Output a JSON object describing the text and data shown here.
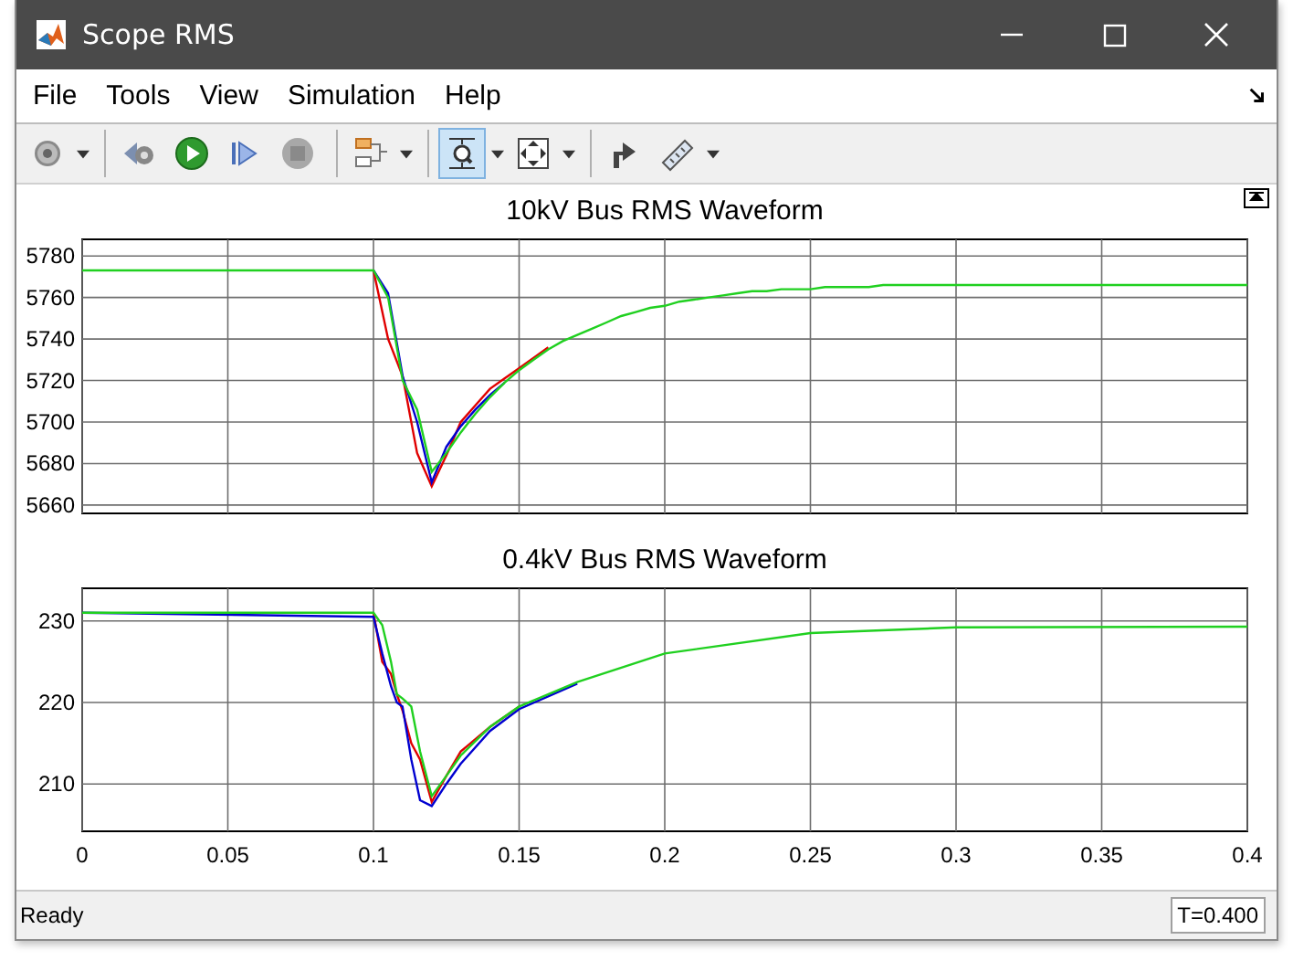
{
  "window": {
    "title": "Scope RMS"
  },
  "menu": [
    "File",
    "Tools",
    "View",
    "Simulation",
    "Help"
  ],
  "toolbar": [
    {
      "kind": "gear",
      "dropdown": true,
      "selected": false
    },
    {
      "kind": "separator"
    },
    {
      "kind": "step-back",
      "dropdown": false,
      "selected": false
    },
    {
      "kind": "run",
      "dropdown": false,
      "selected": false
    },
    {
      "kind": "step-forward",
      "dropdown": false,
      "selected": false
    },
    {
      "kind": "stop",
      "dropdown": false,
      "selected": false
    },
    {
      "kind": "separator"
    },
    {
      "kind": "signals",
      "dropdown": true,
      "selected": false
    },
    {
      "kind": "separator"
    },
    {
      "kind": "zoom",
      "dropdown": true,
      "selected": true
    },
    {
      "kind": "fit",
      "dropdown": true,
      "selected": false
    },
    {
      "kind": "separator"
    },
    {
      "kind": "highlight",
      "dropdown": false,
      "selected": false
    },
    {
      "kind": "ruler",
      "dropdown": true,
      "selected": false
    }
  ],
  "plots": [
    {
      "chart_data": {
        "type": "line",
        "title": "10kV Bus RMS Waveform",
        "grid": true,
        "categories": [
          null,
          null,
          null,
          null,
          null,
          null,
          null,
          null,
          null,
          null,
          null,
          null,
          null,
          null,
          null,
          null,
          null,
          null,
          null,
          null,
          null,
          null,
          null,
          null,
          null,
          null,
          null,
          null,
          null,
          null,
          null,
          null,
          null,
          null,
          null,
          null,
          null,
          null,
          null,
          null,
          null,
          null,
          null,
          null,
          null,
          null,
          null,
          null,
          null,
          null,
          null,
          null,
          null,
          null,
          null,
          null,
          null,
          null,
          null,
          null,
          null,
          null,
          null,
          null,
          null,
          null,
          null,
          null,
          null,
          null,
          null,
          null,
          null,
          null,
          null,
          null,
          null,
          null,
          null,
          null,
          null
        ],
        "series": [
          {
            "color": "#e00000",
            "values": [
              null,
              null,
              null,
              null,
              null,
              null,
              null,
              null,
              null,
              null,
              null,
              null,
              null,
              null,
              null,
              null,
              null,
              null,
              null,
              null,
              5773,
              5740,
              5722,
              5685,
              5669,
              5684,
              5700,
              5708,
              5716,
              5721,
              5726,
              5731,
              5736,
              null,
              null,
              null,
              null,
              null,
              null,
              null,
              null,
              null,
              null,
              null,
              null,
              null,
              null,
              null,
              null,
              null,
              null,
              null,
              null,
              null,
              null,
              null,
              null,
              null,
              null,
              null,
              null,
              null,
              null,
              null,
              null,
              null,
              null,
              null,
              null,
              null,
              null,
              null,
              null,
              null,
              null,
              null,
              null,
              null,
              null,
              null,
              null
            ]
          },
          {
            "color": "#0000d0",
            "values": [
              null,
              null,
              null,
              null,
              null,
              null,
              null,
              null,
              null,
              null,
              null,
              null,
              null,
              null,
              null,
              null,
              null,
              null,
              null,
              null,
              5773,
              5762,
              5722,
              5700,
              5671,
              5688,
              5698,
              5706,
              5713,
              5719,
              null,
              null,
              null,
              null,
              null,
              null,
              null,
              null,
              null,
              null,
              null,
              null,
              null,
              null,
              null,
              null,
              null,
              null,
              null,
              null,
              null,
              null,
              null,
              null,
              null,
              null,
              null,
              null,
              null,
              null,
              null,
              null,
              null,
              null,
              null,
              null,
              null,
              null,
              null,
              null,
              null,
              null,
              null,
              null,
              null,
              null,
              null,
              null,
              null,
              null,
              null
            ]
          },
          {
            "color": "#20d020",
            "values": [
              5773,
              5773,
              5773,
              5773,
              5773,
              5773,
              5773,
              5773,
              5773,
              5773,
              5773,
              5773,
              5773,
              5773,
              5773,
              5773,
              5773,
              5773,
              5773,
              5773,
              5773,
              5760,
              5720,
              5706,
              5676,
              5685,
              5695,
              5704,
              5712,
              5719,
              5725,
              5730,
              5735,
              5739,
              5742,
              5745,
              5748,
              5751,
              5753,
              5755,
              5756,
              5758,
              5759,
              5760,
              5761,
              5762,
              5763,
              5763,
              5764,
              5764,
              5764,
              5765,
              5765,
              5765,
              5765,
              5766,
              5766,
              5766,
              5766,
              5766,
              5766,
              5766,
              5766,
              5766,
              5766,
              5766,
              5766,
              5766,
              5766,
              5766,
              5766,
              5766,
              5766,
              5766,
              5766,
              5766,
              5766,
              5766,
              5766,
              5766,
              5766
            ]
          }
        ],
        "ylim": [
          5656,
          5788
        ],
        "yticks": [
          5660,
          5680,
          5700,
          5720,
          5740,
          5760,
          5780
        ]
      }
    },
    {
      "chart_data": {
        "type": "line",
        "title": "0.4kV Bus RMS Waveform",
        "grid": true,
        "x": [
          0,
          0.1,
          0.103,
          0.106,
          0.108,
          0.11,
          0.113,
          0.116,
          0.12,
          0.125,
          0.13,
          0.14,
          0.15,
          0.17,
          0.2,
          0.25,
          0.3,
          0.4
        ],
        "series": [
          {
            "color": "#e00000",
            "values": [
              null,
              231,
              225,
              223.5,
              221,
              219,
              215,
              213,
              207.8,
              211,
              214,
              217,
              219.5,
              null,
              null,
              null,
              null,
              null
            ]
          },
          {
            "color": "#0000d0",
            "values": [
              231,
              230.5,
              226,
              222,
              220,
              219.5,
              213,
              208,
              207.3,
              210,
              212.5,
              216.5,
              219.2,
              222.3,
              null,
              null,
              null,
              null
            ]
          },
          {
            "color": "#20d020",
            "values": [
              231,
              231,
              229.5,
              225,
              221,
              220.5,
              219.5,
              214,
              208.5,
              211,
              213.5,
              217,
              219.5,
              222.5,
              226,
              228.5,
              229.2,
              229.3
            ]
          }
        ],
        "xlim": [
          0,
          0.4
        ],
        "ylim": [
          204.2,
          234
        ],
        "xticks": [
          0,
          0.05,
          0.1,
          0.15,
          0.2,
          0.25,
          0.3,
          0.35,
          0.4
        ],
        "yticks": [
          210,
          220,
          230
        ]
      }
    }
  ],
  "status_bar": {
    "text": "Ready",
    "time": "T=0.400"
  }
}
